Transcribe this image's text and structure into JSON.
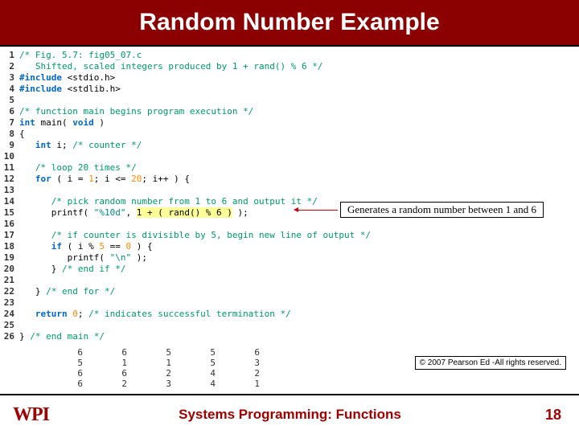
{
  "title": "Random Number Example",
  "code": {
    "l1": "/* Fig. 5.7: fig05_07.c",
    "l2": "   Shifted, scaled integers produced by 1 + rand() % 6 */",
    "l3a": "#include",
    "l3b": " <stdio.h>",
    "l4a": "#include",
    "l4b": " <stdlib.h>",
    "l6": "/* function main begins program execution */",
    "l7a": "int",
    "l7b": " main(",
    "l7c": " void",
    "l7d": " )",
    "l8": "{",
    "l9a": "   int",
    "l9b": " i; ",
    "l9c": "/* counter */",
    "l11": "   /* loop 20 times */",
    "l12a": "   for",
    "l12b": " ( i = ",
    "l12c": "1",
    "l12d": "; i <= ",
    "l12e": "20",
    "l12f": "; i++ ) {",
    "l14": "      /* pick random number from 1 to 6 and output it */",
    "l15a": "      printf( ",
    "l15b": "\"%10d\"",
    "l15c": ", ",
    "l15d": "1 + ( rand() % 6 )",
    "l15e": " );",
    "l17": "      /* if counter is divisible by 5, begin new line of output */",
    "l18a": "      if",
    "l18b": " ( i % ",
    "l18c": "5",
    "l18d": " == ",
    "l18e": "0",
    "l18f": " ) {",
    "l19a": "         printf( ",
    "l19b": "\"\\n\"",
    "l19c": " );",
    "l20": "      } ",
    "l20b": "/* end if */",
    "l22": "   } ",
    "l22b": "/* end for */",
    "l24a": "   return",
    "l24b": " ",
    "l24c": "0",
    "l24d": "; ",
    "l24e": "/* indicates successful termination */",
    "l26": "} ",
    "l26b": "/* end main */"
  },
  "linenos": [
    "1",
    "2",
    "3",
    "4",
    "5",
    "6",
    "7",
    "8",
    "9",
    "10",
    "11",
    "12",
    "13",
    "14",
    "15",
    "16",
    "17",
    "18",
    "19",
    "20",
    "21",
    "22",
    "23",
    "24",
    "25",
    "26"
  ],
  "annotation": "Generates a random number between 1 and 6",
  "output": [
    [
      "6",
      "6",
      "5",
      "5",
      "6"
    ],
    [
      "5",
      "1",
      "1",
      "5",
      "3"
    ],
    [
      "6",
      "6",
      "2",
      "4",
      "2"
    ],
    [
      "6",
      "2",
      "3",
      "4",
      "1"
    ]
  ],
  "copyright": "© 2007 Pearson Ed -All rights reserved.",
  "footer": {
    "logo": "WPI",
    "title": "Systems Programming:   Functions",
    "page": "18"
  }
}
